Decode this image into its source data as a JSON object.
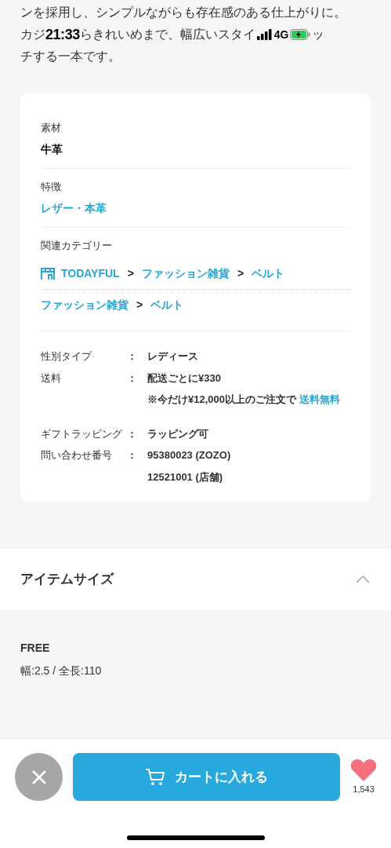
{
  "description": {
    "lines": [
      {
        "segments": [
          {
            "kind": "text",
            "text": "ンを採用し、シンプルながらも存在感のある仕上がりに。"
          }
        ]
      },
      {
        "segments": [
          {
            "kind": "text",
            "text": "カジ"
          },
          {
            "kind": "time",
            "text": "21:33"
          },
          {
            "kind": "text",
            "text": "らきれいめまで、幅広いスタイ"
          },
          {
            "kind": "signal"
          },
          {
            "kind": "network",
            "text": "4G"
          },
          {
            "kind": "battery"
          },
          {
            "kind": "text",
            "text": "ッ"
          }
        ]
      },
      {
        "segments": [
          {
            "kind": "text",
            "text": "チする一本です。"
          }
        ]
      }
    ]
  },
  "details": {
    "fields": [
      {
        "kind": "plain",
        "label": "素材",
        "value": "牛革"
      },
      {
        "kind": "link",
        "label": "特徴",
        "value": "レザー・本革"
      },
      {
        "kind": "categories",
        "label": "関連カテゴリー",
        "paths": [
          {
            "items": [
              {
                "kind": "shop",
                "text": "TODAYFUL"
              },
              {
                "kind": "sep",
                "text": ">"
              },
              {
                "kind": "link",
                "text": "ファッション雑貨"
              },
              {
                "kind": "sep",
                "text": ">"
              },
              {
                "kind": "link",
                "text": "ベルト"
              }
            ]
          },
          {
            "items": [
              {
                "kind": "link",
                "text": "ファッション雑貨"
              },
              {
                "kind": "sep",
                "text": ">"
              },
              {
                "kind": "link",
                "text": "ベルト"
              }
            ]
          }
        ]
      }
    ],
    "specs": [
      {
        "label": "性別タイプ",
        "colon": "：",
        "values": [
          {
            "text": "レディース"
          }
        ]
      },
      {
        "label": "送料",
        "colon": "：",
        "values": [
          {
            "text": "配送ごとに¥330"
          },
          {
            "text": "※今だけ¥12,000以上のご注文で ",
            "link": "送料無料"
          }
        ]
      },
      {
        "label": "ギフトラッピング",
        "colon": "：",
        "values": [
          {
            "text": "ラッピング可"
          }
        ]
      },
      {
        "label": "問い合わせ番号",
        "colon": "：",
        "values": [
          {
            "text": "95380023 (ZOZO)"
          },
          {
            "text": "12521001 (店舗)"
          }
        ]
      }
    ]
  },
  "item_size": {
    "title": "アイテムサイズ",
    "expanded": true,
    "sizes": [
      {
        "name": "FREE",
        "measurements": "幅:2.5 / 全長:110"
      }
    ]
  },
  "bottom_bar": {
    "cart_button": "カートに入れる",
    "favorite_count": "1,543"
  }
}
